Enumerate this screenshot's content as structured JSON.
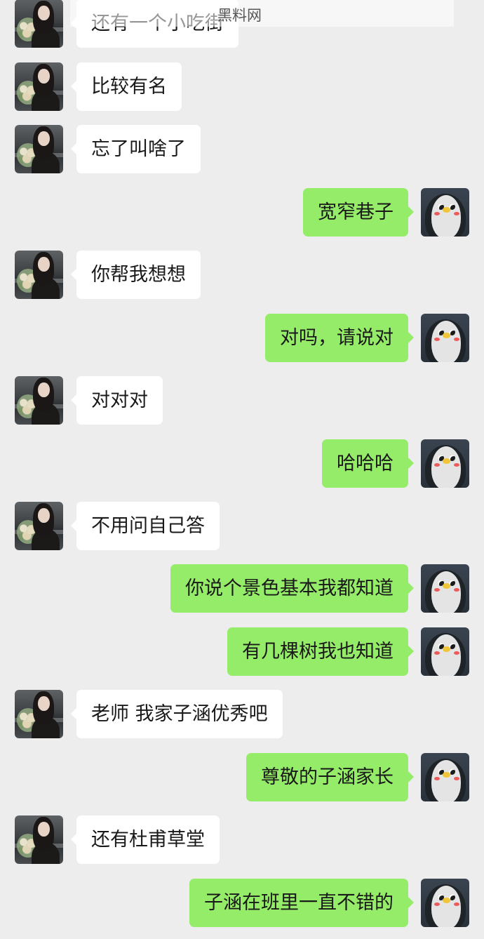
{
  "watermark": "黑料网",
  "messages": [
    {
      "side": "left",
      "text": "还有一个小吃街"
    },
    {
      "side": "left",
      "text": "比较有名"
    },
    {
      "side": "left",
      "text": "忘了叫啥了"
    },
    {
      "side": "right",
      "text": "宽窄巷子"
    },
    {
      "side": "left",
      "text": "你帮我想想"
    },
    {
      "side": "right",
      "text": "对吗，请说对"
    },
    {
      "side": "left",
      "text": "对对对"
    },
    {
      "side": "right",
      "text": "哈哈哈"
    },
    {
      "side": "left",
      "text": "不用问自己答"
    },
    {
      "side": "right",
      "text": "你说个景色基本我都知道"
    },
    {
      "side": "right",
      "text": "有几棵树我也知道"
    },
    {
      "side": "left",
      "text": "老师 我家子涵优秀吧"
    },
    {
      "side": "right",
      "text": "尊敬的子涵家长"
    },
    {
      "side": "left",
      "text": "还有杜甫草堂"
    },
    {
      "side": "right",
      "text": "子涵在班里一直不错的"
    }
  ],
  "avatars": {
    "left": "girl-with-flowers-avatar",
    "right": "penguin-sticker-avatar"
  },
  "colors": {
    "background": "#ededed",
    "incoming_bubble": "#ffffff",
    "outgoing_bubble": "#95ec69"
  }
}
